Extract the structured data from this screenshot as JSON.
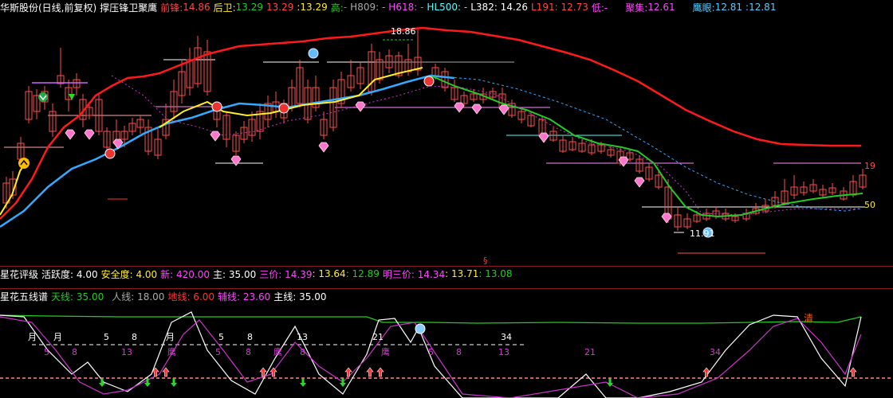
{
  "colors": {
    "up": "#ff4d4d",
    "down": "#55ffff",
    "ma_red": "#ff1a1a",
    "ma_blue": "#33aaff",
    "ma_yellow": "#ffee22",
    "ma_green": "#22cc22",
    "ma_magenta": "#cc33cc",
    "grid": "#8b1a1a"
  },
  "main_header": {
    "stock_title": "华斯股份(日线,前复权)",
    "indicator": "撑压锋卫聚鹰",
    "qian_feng_label": "前锋:",
    "qian_feng_value": "14.86",
    "hou_wei_label": "后卫:",
    "hou_wei_value_1": "13.29",
    "hou_wei_value_2": "13.29",
    "hou_wei_value_3": "13.29",
    "gao_label": "高:",
    "gao_value": "-",
    "h809": "H809: -",
    "h618": "H618: -",
    "hl500": "HL500: -",
    "l382": "L382: 14.26",
    "l191": "L191: 12.73",
    "di": "低:-",
    "ju_ji_label": "聚集:",
    "ju_ji_value": "12.61",
    "ying_yan_label": "鹰眼:",
    "ying_yan_value_1": "12.81",
    "ying_yan_value_2": "12.81"
  },
  "main_chart": {
    "high_marker": "18.86",
    "low_marker": "11.91",
    "right_label_top": "19",
    "right_label_bottom": "50",
    "section_mark": "§"
  },
  "star_header": {
    "title": "星花评级",
    "huo_yue": "活跃度: 4.00",
    "an_quan": "安全度: 4.00",
    "xin": "新: 420.00",
    "zhu": "主: 35.00",
    "san_jia": "三价: 14.39",
    "san_jia_2": ": 13.64",
    "san_jia_3": ": 12.89",
    "ming_san_jia": "明三价: 14.34",
    "ming_san_jia_2": ": 13.71",
    "ming_san_jia_3": ": 13.08"
  },
  "five_header": {
    "title": "星花五线谱",
    "tian_xian": "天线: 35.00",
    "ren_xian": "人线: 18.00",
    "di_xian": "地线: 6.00",
    "fu_xian": "辅线: 23.60",
    "zhu_xian": "主线: 35.00"
  },
  "lower_chart": {
    "labels_white": [
      "月",
      "月",
      "5",
      "8",
      "月",
      "5",
      "8",
      "13",
      "21",
      "34"
    ],
    "labels_magenta": [
      "5",
      "8",
      "13",
      "鹰",
      "5",
      "8",
      "鹰",
      "8",
      "鹰",
      "5",
      "8",
      "13",
      "21",
      "34"
    ],
    "qing": "清"
  }
}
